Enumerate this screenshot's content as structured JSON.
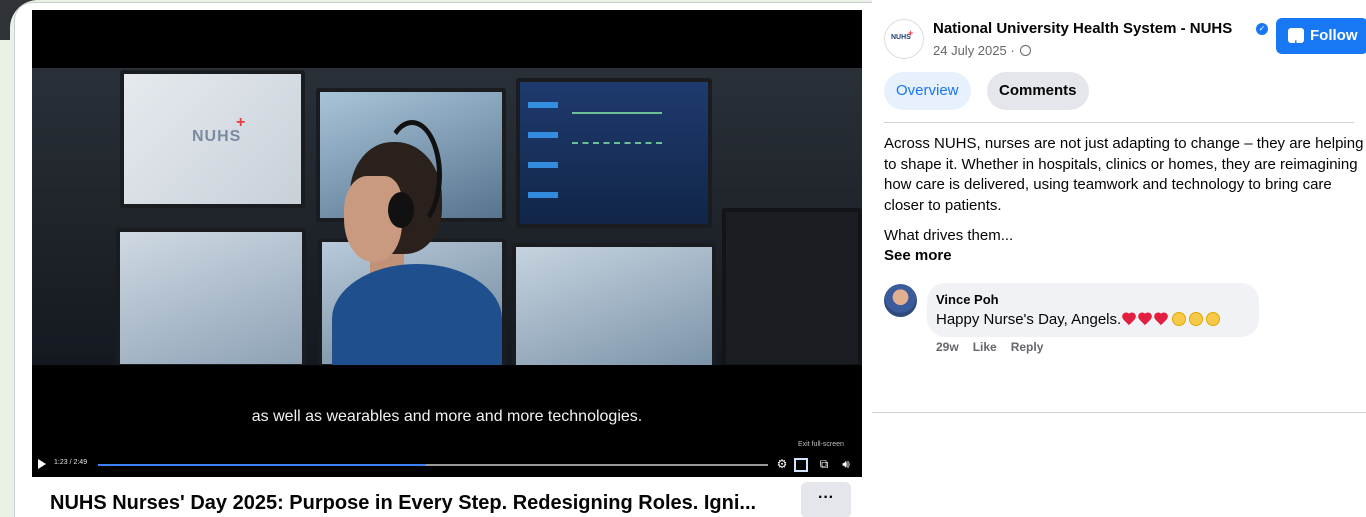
{
  "video": {
    "subtitle": "as well as wearables and more and more technologies.",
    "exit_fullscreen_label": "Exit full-screen",
    "time_display": "1:23 / 2:49",
    "progress_fraction": 0.49,
    "screen_logo": "NUHS",
    "title": "NUHS Nurses' Day 2025: Purpose in Every Step. Redesigning Roles. Igni...",
    "more_label": "···"
  },
  "post": {
    "page_name": "National University Health System - NUHS",
    "date": "24 July 2025 · ",
    "follow_label": "Follow",
    "avatar_text": "NUHS",
    "tabs": [
      {
        "label": "Overview",
        "active": true
      },
      {
        "label": "Comments",
        "active": false
      }
    ],
    "description": "Across NUHS, nurses are not just adapting to change – they are helping to shape it. Whether in hospitals, clinics or homes, they are reimagining how care is delivered, using teamwork and technology to bring care closer to patients.",
    "description_2": "What drives them...",
    "see_more_label": "See more"
  },
  "comment": {
    "author": "Vince Poh",
    "text": "Happy Nurse's Day, Angels.",
    "age": "29w",
    "like_label": "Like",
    "reply_label": "Reply"
  },
  "colors": {
    "accent": "#1877f2",
    "heart": "#e41e3f",
    "text_secondary": "#65676b"
  }
}
